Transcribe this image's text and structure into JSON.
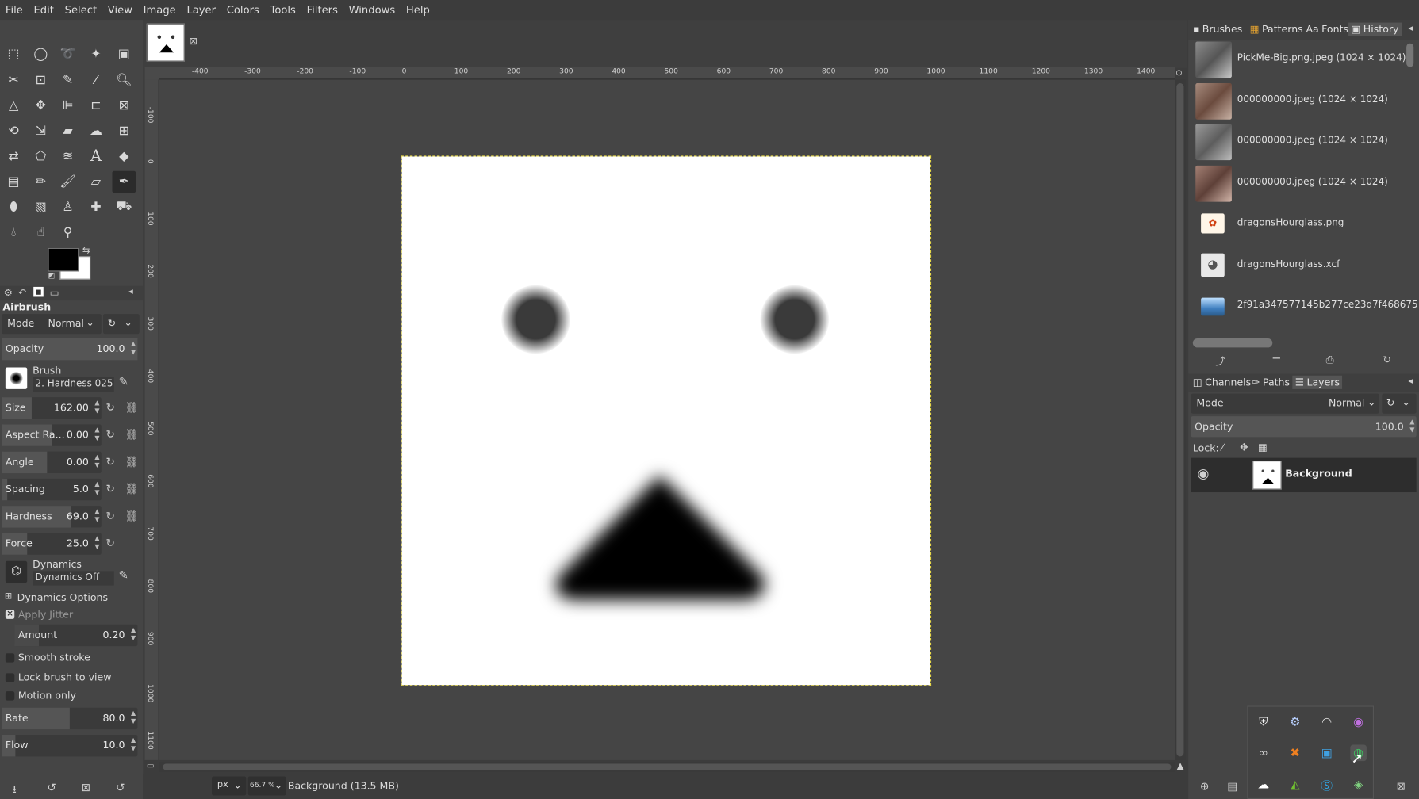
{
  "menubar": {
    "items": [
      "File",
      "Edit",
      "Select",
      "View",
      "Image",
      "Layer",
      "Colors",
      "Tools",
      "Filters",
      "Windows",
      "Help"
    ]
  },
  "tool_options": {
    "title": "Airbrush",
    "mode_label": "Mode",
    "mode_value": "Normal",
    "opacity": {
      "label": "Opacity",
      "value": "100.0"
    },
    "brush": {
      "label": "Brush",
      "value": "2. Hardness 025"
    },
    "size": {
      "label": "Size",
      "value": "162.00"
    },
    "aspect": {
      "label": "Aspect Ra...",
      "value": "0.00"
    },
    "angle": {
      "label": "Angle",
      "value": "0.00"
    },
    "spacing": {
      "label": "Spacing",
      "value": "5.0"
    },
    "hardness": {
      "label": "Hardness",
      "value": "69.0"
    },
    "force": {
      "label": "Force",
      "value": "25.0"
    },
    "dynamics": {
      "label": "Dynamics",
      "value": "Dynamics Off"
    },
    "dynamics_options": "Dynamics Options",
    "apply_jitter": "Apply Jitter",
    "amount": {
      "label": "Amount",
      "value": "0.20"
    },
    "smooth_stroke": "Smooth stroke",
    "lock_brush": "Lock brush to view",
    "motion_only": "Motion only",
    "rate": {
      "label": "Rate",
      "value": "80.0"
    },
    "flow": {
      "label": "Flow",
      "value": "10.0"
    }
  },
  "ruler": {
    "h_ticks": [
      "-400",
      "-300",
      "-200",
      "-100",
      "0",
      "100",
      "200",
      "300",
      "400",
      "500",
      "600",
      "700",
      "800",
      "900",
      "1000",
      "1100",
      "1200",
      "1300",
      "1400"
    ],
    "v_ticks": [
      "-100",
      "0",
      "100",
      "200",
      "300",
      "400",
      "500",
      "600",
      "700",
      "800",
      "900",
      "1000",
      "1100"
    ]
  },
  "status": {
    "unit": "px",
    "zoom": "66.7 %",
    "info": "Background (13.5 MB)"
  },
  "dock_top": {
    "tabs": [
      "Brushes",
      "Patterns",
      "Fonts",
      "History"
    ],
    "history": [
      "PickMe-Big.png.jpeg (1024 × 1024)",
      "000000000.jpeg (1024 × 1024)",
      "000000000.jpeg (1024 × 1024)",
      "000000000.jpeg (1024 × 1024)",
      "dragonsHourglass.png",
      "dragonsHourglass.xcf",
      "2f91a347577145b277ce23d7f468675"
    ]
  },
  "dock_bottom": {
    "tabs": [
      "Channels",
      "Paths",
      "Layers"
    ],
    "mode_label": "Mode",
    "mode_value": "Normal",
    "opacity_label": "Opacity",
    "opacity_value": "100.0",
    "lock_label": "Lock:",
    "layer_name": "Background"
  },
  "colors": {
    "fg": "#000000",
    "bg": "#ffffff",
    "accent": "#e6d84a"
  }
}
